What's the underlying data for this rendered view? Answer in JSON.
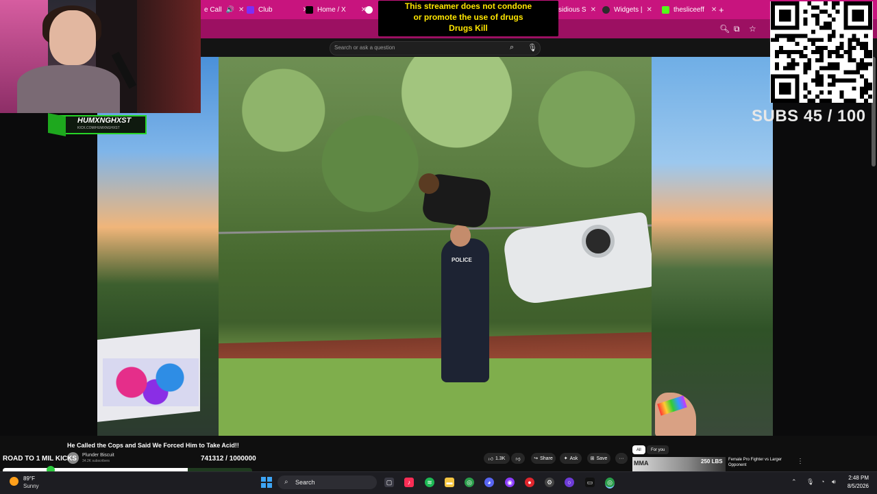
{
  "browser": {
    "tabs": [
      {
        "label": "e Call",
        "color": "#333333"
      },
      {
        "label": "Club",
        "color": "#7b2ff7"
      },
      {
        "label": "Home / X",
        "color": "#000000"
      },
      {
        "label": "sidious S",
        "color": "#444444"
      },
      {
        "label": "Widgets |",
        "color": "#2c2c2c"
      },
      {
        "label": "thesliceeff",
        "color": "#53fc18"
      }
    ],
    "new_tab": "+",
    "accent_color": "#c8147e"
  },
  "page_search": {
    "placeholder": "Search or ask a question"
  },
  "warning": {
    "line1": "This streamer does not condone",
    "line2": "or promote the use of drugs",
    "line3": "Drugs Kill"
  },
  "overlay": {
    "subs_text": "SUBS 45 / 100",
    "streamer_name": "HUMXNGHXST",
    "streamer_url": "KICK.COM/HUMXNGHXST",
    "road_label": "ROAD TO 1 MIL KICKS",
    "kicks_count": "741312 / 1000000",
    "kicks_progress": 0.741312
  },
  "video": {
    "title": "He Called the Cops and Said We Forced Him to Take Acid!!",
    "channel_name": "Plunder Biscuit",
    "subscribers": "34.2K subscribers",
    "police_label": "POLICE"
  },
  "actions": {
    "likes": "1.3K",
    "share": "Share",
    "ask": "Ask",
    "save": "Save",
    "more": "···"
  },
  "chips": {
    "all": "All",
    "for_you": "For you"
  },
  "recommendation": {
    "thumb_text_left": "MMA",
    "thumb_text_right": "250 LBS",
    "title": "Female Pro Fighter vs Larger Opponent"
  },
  "taskbar": {
    "temperature": "89°F",
    "condition": "Sunny",
    "search": "Search",
    "time": "2:48 PM",
    "date": "8/5/2026"
  }
}
